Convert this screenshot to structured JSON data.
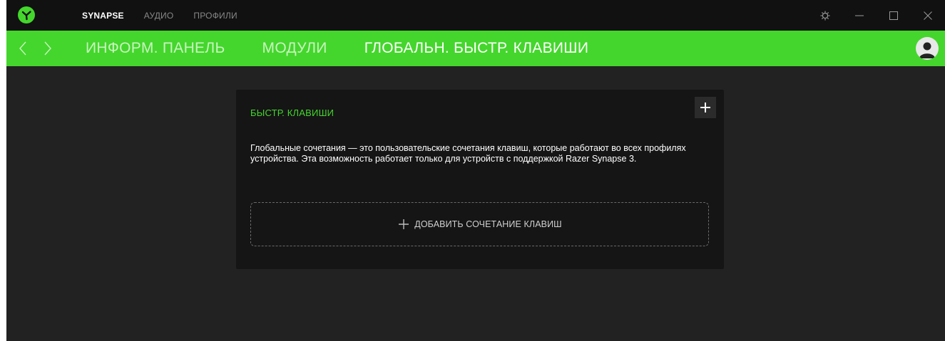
{
  "titlebar": {
    "logo_icon": "razer-logo-icon",
    "tabs": [
      {
        "label": "SYNAPSE",
        "active": true
      },
      {
        "label": "АУДИО",
        "active": false
      },
      {
        "label": "ПРОФИЛИ",
        "active": false
      }
    ],
    "controls": [
      "settings-icon",
      "minimize-icon",
      "maximize-icon",
      "close-icon"
    ]
  },
  "subheader": {
    "tabs": [
      {
        "label": "ИНФОРМ. ПАНЕЛЬ",
        "active": false
      },
      {
        "label": "МОДУЛИ",
        "active": false
      },
      {
        "label": "ГЛОБАЛЬН. БЫСТР. КЛАВИШИ",
        "active": true
      }
    ],
    "avatar_icon": "user-avatar-icon"
  },
  "card": {
    "title": "БЫСТР. КЛАВИШИ",
    "description": "Глобальные сочетания — это пользовательские сочетания клавиш, которые работают во всех профилях устройства. Эта возможность работает только для устройств с поддержкой Razer Synapse 3.",
    "add_label": "ДОБАВИТЬ СОЧЕТАНИЕ КЛАВИШ"
  },
  "colors": {
    "accent": "#44d62c",
    "titlebar_bg": "#111111",
    "content_bg": "#222222",
    "card_bg": "#151515"
  }
}
